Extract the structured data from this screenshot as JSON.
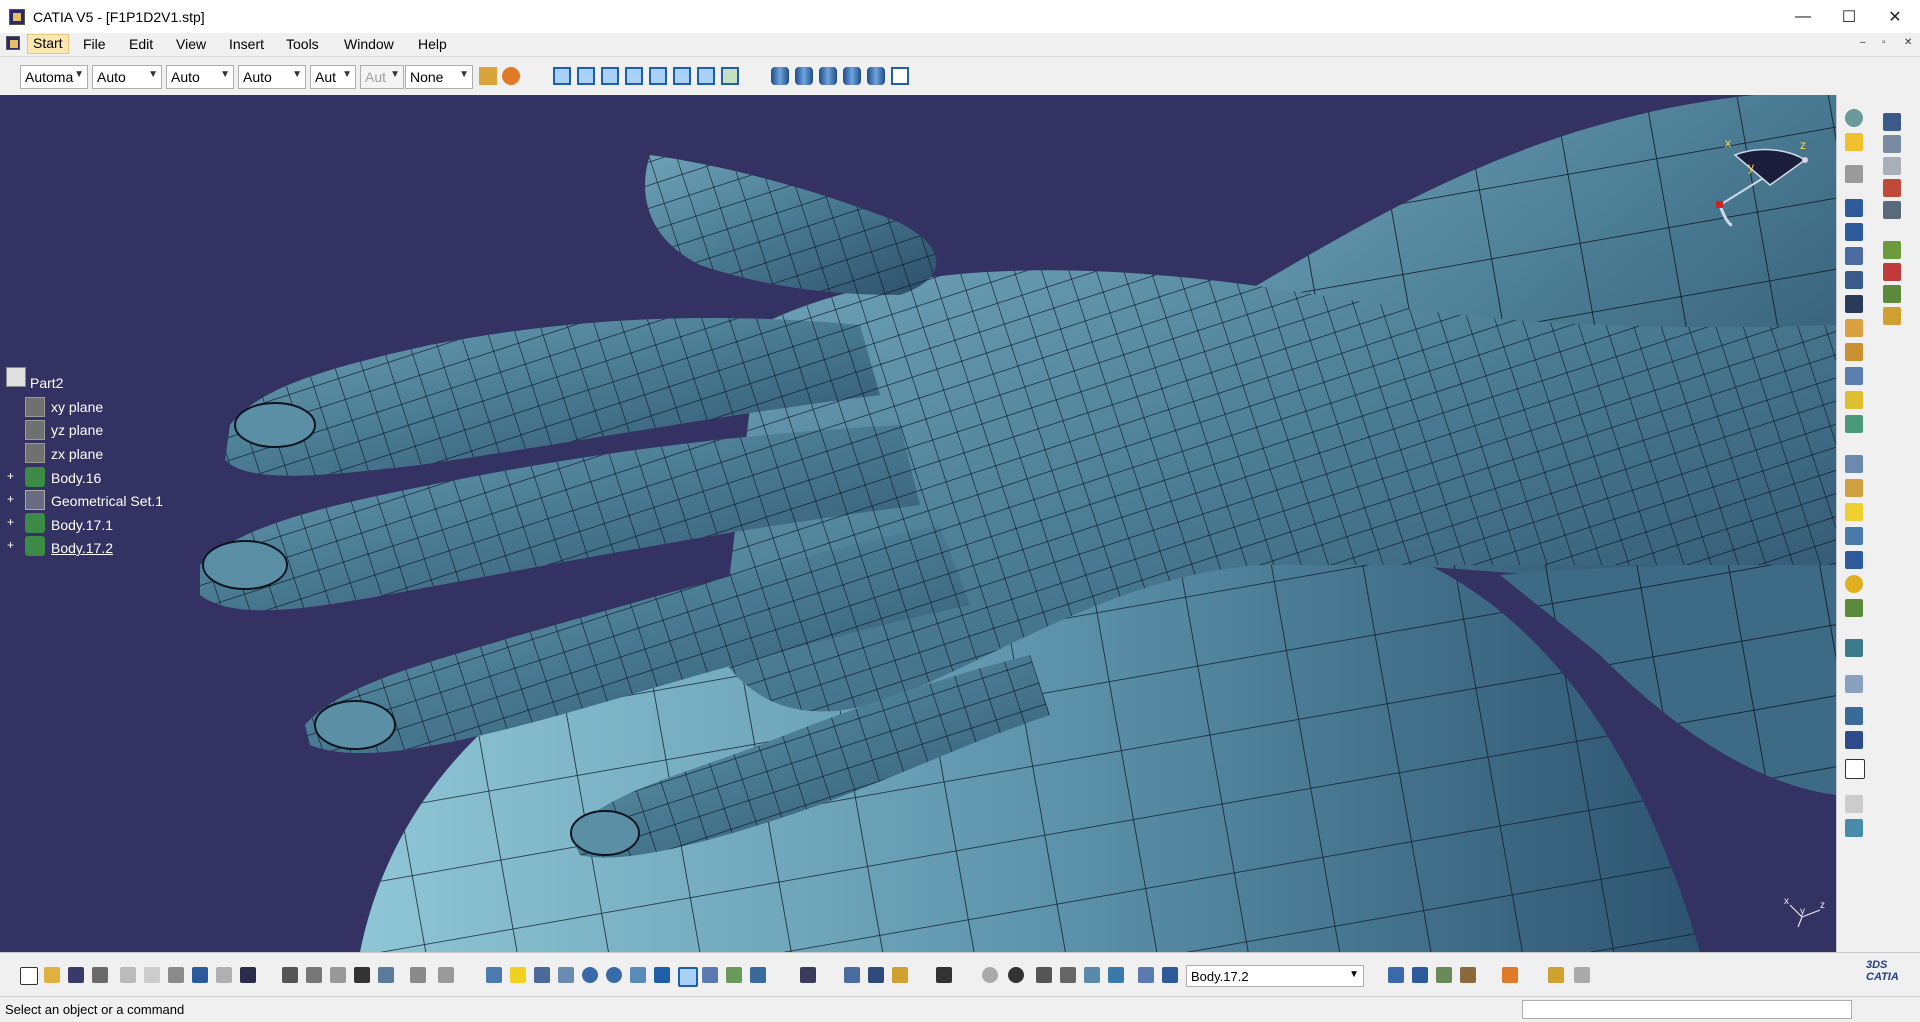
{
  "window": {
    "title": "CATIA V5 - [F1P1D2V1.stp]",
    "minimize_glyph": "—",
    "maximize_glyph": "☐",
    "close_glyph": "✕"
  },
  "menu": {
    "items": [
      "Start",
      "File",
      "Edit",
      "View",
      "Insert",
      "Tools",
      "Window",
      "Help"
    ],
    "active": "Start",
    "mdi_controls": [
      "–",
      "▫",
      "✕"
    ]
  },
  "toolbar_top": {
    "combos": [
      {
        "value": "Automa",
        "disabled": false
      },
      {
        "value": "Auto",
        "disabled": false
      },
      {
        "value": "Auto",
        "disabled": false
      },
      {
        "value": "Auto",
        "disabled": false
      },
      {
        "value": "Aut",
        "disabled": false
      },
      {
        "value": "Aut",
        "disabled": true
      },
      {
        "value": "None",
        "disabled": false
      }
    ]
  },
  "tree": {
    "root": "Part2",
    "children": [
      {
        "label": "xy plane",
        "icon": "plane-icon",
        "expandable": false
      },
      {
        "label": "yz plane",
        "icon": "plane-icon",
        "expandable": false
      },
      {
        "label": "zx plane",
        "icon": "plane-icon",
        "expandable": false
      },
      {
        "label": "Body.16",
        "icon": "body-icon",
        "expandable": true
      },
      {
        "label": "Geometrical Set.1",
        "icon": "geometrical-set-icon",
        "expandable": true
      },
      {
        "label": "Body.17.1",
        "icon": "body-icon",
        "expandable": true
      },
      {
        "label": "Body.17.2",
        "icon": "body-icon",
        "expandable": true,
        "selected": true
      }
    ]
  },
  "compass": {
    "x": "x",
    "y": "y",
    "z": "z"
  },
  "axis_indicator": {
    "x": "x",
    "y": "y",
    "z": "z"
  },
  "toolbar_bottom": {
    "current_body": "Body.17.2"
  },
  "status": {
    "message": "Select an object or a command"
  },
  "colors": {
    "viewport_bg": "#343263",
    "model_surface": "#5a8fa6",
    "model_highlight": "#9fd3dc",
    "mesh_lines": "#0c1420"
  }
}
